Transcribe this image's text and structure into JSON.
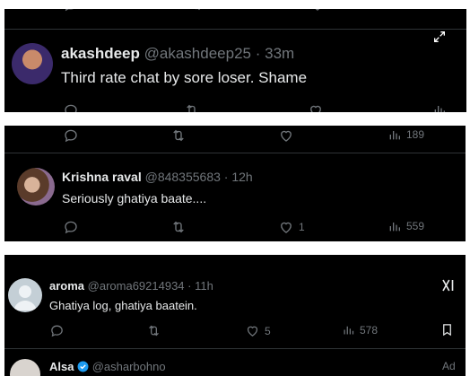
{
  "posts": [
    {
      "display_name": "akashdeep",
      "handle": "@akashdeep25",
      "sep": "·",
      "time": "33m",
      "text": "Third rate chat by sore loser. Shame"
    },
    {
      "display_name": "Krishna raval",
      "handle": "@848355683",
      "sep": "·",
      "time": "12h",
      "text": "Seriously ghatiya baate....",
      "likes": "1",
      "views": "559"
    },
    {
      "display_name": "aroma",
      "handle": "@aroma69214934",
      "sep": "·",
      "time": "11h",
      "text": "Ghatiya log, ghatiya baatein.",
      "likes": "5",
      "views": "578"
    },
    {
      "display_name": "Alsa",
      "handle": "@asharbohno",
      "badge": "Ad"
    }
  ],
  "top_actions": {
    "views": "189"
  },
  "icons": {
    "reply": "reply-icon",
    "repost": "repost-icon",
    "like": "heart-icon",
    "views": "views-icon",
    "expand": "expand-icon",
    "grok": "grok-icon",
    "bookmark": "bookmark-icon",
    "verified": "verified-icon"
  },
  "colors": {
    "background": "#000000",
    "text": "#e7e9ea",
    "muted": "#71767b",
    "verified": "#1d9bf0"
  }
}
